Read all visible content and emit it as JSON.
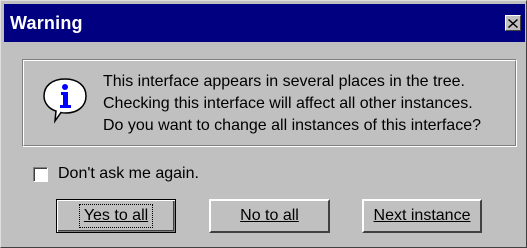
{
  "window": {
    "title": "Warning",
    "close_icon": "close-icon"
  },
  "message": {
    "icon": "info-icon",
    "lines": [
      "This interface appears in several places in the tree.",
      "Checking this interface will affect all other instances.",
      "Do you want to change all instances of this interface?"
    ]
  },
  "checkbox": {
    "label": "Don't ask me again.",
    "checked": false
  },
  "buttons": {
    "yes_to_all": "Yes to all",
    "no_to_all": "No to all",
    "next_instance": "Next instance"
  },
  "colors": {
    "title_bar": "#000080",
    "face": "#c0c0c0",
    "icon_bubble": "#ffffff",
    "icon_letter": "#0000ff"
  }
}
